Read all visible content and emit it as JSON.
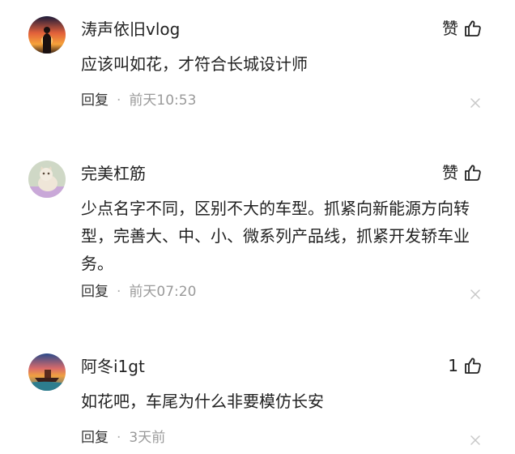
{
  "comments": [
    {
      "username": "涛声依旧vlog",
      "like_label": "赞",
      "content": "应该叫如花，才符合长城设计师",
      "reply_label": "回复",
      "separator": "·",
      "time": "前天10:53"
    },
    {
      "username": "完美杠筋",
      "like_label": "赞",
      "content": "少点名字不同，区别不大的车型。抓紧向新能源方向转型，完善大、中、小、微系列产品线，抓紧开发轿车业务。",
      "reply_label": "回复",
      "separator": "·",
      "time": "前天07:20"
    },
    {
      "username": "阿冬i1gt",
      "like_label": "1",
      "content": "如花吧，车尾为什么非要模仿长安",
      "reply_label": "回复",
      "separator": "·",
      "time": "3天前"
    }
  ],
  "icons": {
    "like": "thumbs-up-icon",
    "close": "close-icon",
    "avatar": "avatar"
  },
  "colors": {
    "text": "#222222",
    "meta": "#9a9a9a",
    "close": "#c8c8c8"
  }
}
